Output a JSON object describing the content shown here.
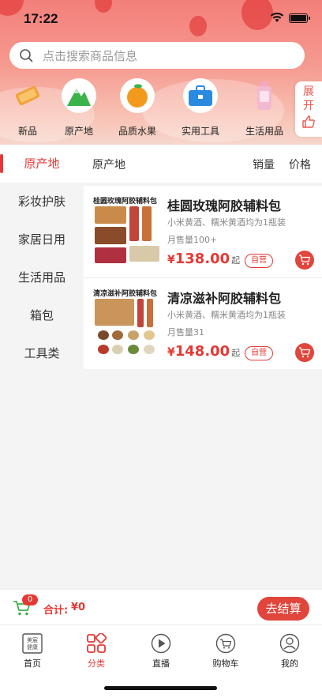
{
  "status": {
    "time": "17:22"
  },
  "search": {
    "placeholder": "点击搜索商品信息"
  },
  "categories": [
    {
      "label": "新品",
      "icon": "new-tag-icon"
    },
    {
      "label": "原产地",
      "icon": "mountain-icon"
    },
    {
      "label": "品质水果",
      "icon": "orange-fruit-icon"
    },
    {
      "label": "实用工具",
      "icon": "toolbox-icon"
    },
    {
      "label": "生活用品",
      "icon": "lotion-bottle-icon"
    }
  ],
  "expand": {
    "line1": "展",
    "line2": "开"
  },
  "sidebar": {
    "active_index": 0,
    "items": [
      "原产地",
      "彩妆护肤",
      "家居日用",
      "生活用品",
      "箱包",
      "工具类"
    ]
  },
  "filter": {
    "current": "原产地",
    "sales": "销量",
    "price": "价格"
  },
  "products": [
    {
      "title": "桂圆玫瑰阿胶辅料包",
      "thumb_caption": "桂圆玫瑰阿胶辅料包",
      "desc": "小米黄酒、糯米黄酒均为1瓶装",
      "sales": "月售量100+",
      "currency": "¥",
      "price": "138.00",
      "price_suffix": "起",
      "badge": "自营"
    },
    {
      "title": "清凉滋补阿胶辅料包",
      "thumb_caption": "清凉滋补阿胶辅料包",
      "desc": "小米黄酒、糯米黄酒均为1瓶装",
      "sales": "月售量31",
      "currency": "¥",
      "price": "148.00",
      "price_suffix": "起",
      "badge": "自营"
    }
  ],
  "checkout": {
    "count": "0",
    "total_label": "合计:",
    "total_value": "¥0",
    "button": "去结算"
  },
  "tabs": [
    {
      "label": "首页",
      "icon": "home-logo-icon",
      "active": false,
      "logo_text": "美宸健康"
    },
    {
      "label": "分类",
      "icon": "category-grid-icon",
      "active": true
    },
    {
      "label": "直播",
      "icon": "play-icon",
      "active": false
    },
    {
      "label": "购物车",
      "icon": "cart-icon",
      "active": false
    },
    {
      "label": "我的",
      "icon": "user-icon",
      "active": false
    }
  ],
  "colors": {
    "accent": "#e53935",
    "button": "#e0463c",
    "header_top": "#f47f7a"
  }
}
